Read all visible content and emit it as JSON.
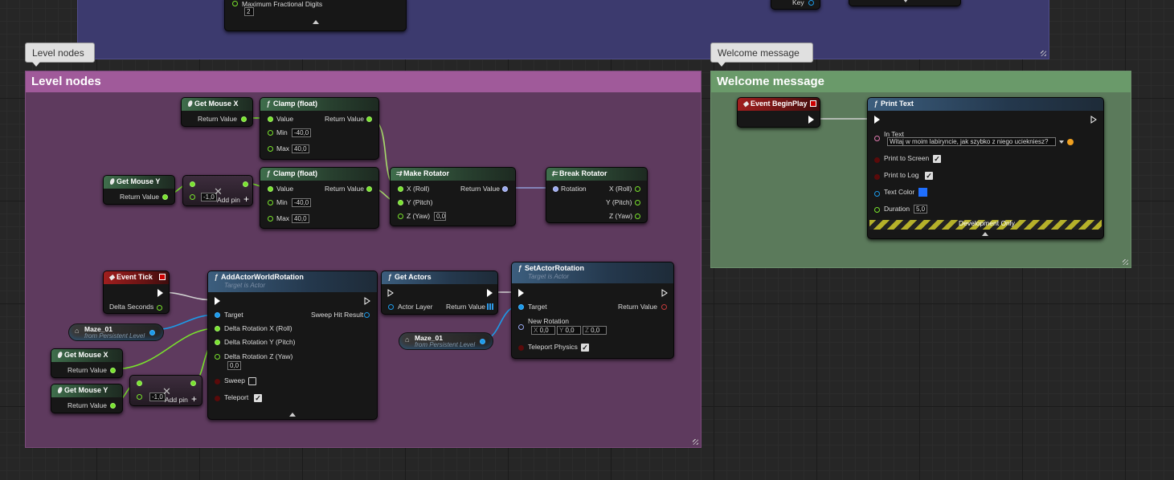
{
  "top_partial": {
    "max_fractional_digits_label": "Maximum Fractional Digits",
    "max_fractional_digits_value": "2",
    "key_label": "Key"
  },
  "comments": {
    "level": {
      "title": "Level nodes",
      "bubble": "Level nodes",
      "color": "#a05a9a"
    },
    "welcome": {
      "title": "Welcome message",
      "bubble": "Welcome message",
      "color": "#6a9a6a"
    }
  },
  "nodes": {
    "get_mouse_x_1": {
      "title": "Get Mouse X",
      "out": "Return Value"
    },
    "clamp_1": {
      "title": "Clamp (float)",
      "value": "Value",
      "return": "Return Value",
      "min": "Min",
      "min_val": "-40,0",
      "max": "Max",
      "max_val": "40,0"
    },
    "get_mouse_y_1": {
      "title": "Get Mouse Y",
      "out": "Return Value"
    },
    "multiply_1": {
      "val": "-1,0",
      "add_pin": "Add pin"
    },
    "clamp_2": {
      "title": "Clamp (float)",
      "value": "Value",
      "return": "Return Value",
      "min": "Min",
      "min_val": "-40,0",
      "max": "Max",
      "max_val": "40,0"
    },
    "make_rotator": {
      "title": "Make Rotator",
      "x": "X (Roll)",
      "y": "Y (Pitch)",
      "z": "Z (Yaw)",
      "z_val": "0,0",
      "return": "Return Value"
    },
    "break_rotator": {
      "title": "Break Rotator",
      "rotation": "Rotation",
      "x": "X (Roll)",
      "y": "Y (Pitch)",
      "z": "Z (Yaw)"
    },
    "event_tick": {
      "title": "Event Tick",
      "delta": "Delta Seconds"
    },
    "add_rotation": {
      "title": "AddActorWorldRotation",
      "subtitle": "Target is Actor",
      "target": "Target",
      "sweep_hit": "Sweep Hit Result",
      "dx": "Delta Rotation X (Roll)",
      "dy": "Delta Rotation Y (Pitch)",
      "dz": "Delta Rotation Z (Yaw)",
      "dz_val": "0,0",
      "sweep": "Sweep",
      "sweep_checked": false,
      "teleport": "Teleport",
      "teleport_checked": true
    },
    "maze_var_1": {
      "name": "Maze_01",
      "sub": "from Persistent Level"
    },
    "get_mouse_x_2": {
      "title": "Get Mouse X",
      "out": "Return Value"
    },
    "get_mouse_y_2": {
      "title": "Get Mouse Y",
      "out": "Return Value"
    },
    "multiply_2": {
      "val": "-1,0",
      "add_pin": "Add pin"
    },
    "get_actors": {
      "title": "Get Actors",
      "layer": "Actor Layer",
      "return": "Return Value"
    },
    "maze_var_2": {
      "name": "Maze_01",
      "sub": "from Persistent Level"
    },
    "set_rotation": {
      "title": "SetActorRotation",
      "subtitle": "Target is Actor",
      "target": "Target",
      "return": "Return Value",
      "new_rotation": "New Rotation",
      "x_lbl": "X",
      "x_val": "0,0",
      "y_lbl": "Y",
      "y_val": "0,0",
      "z_lbl": "Z",
      "z_val": "0,0",
      "teleport": "Teleport Physics",
      "teleport_checked": true
    },
    "begin_play": {
      "title": "Event BeginPlay"
    },
    "print_text": {
      "title": "Print Text",
      "in_text": "In Text",
      "in_text_val": "Witaj w moim labiryncie, jak szybko z niego uciekniesz?",
      "to_screen": "Print to Screen",
      "to_log": "Print to Log",
      "text_color": "Text Color",
      "text_color_hex": "#1f6fff",
      "duration": "Duration",
      "duration_val": "5,0",
      "dev_only": "Development Only"
    }
  }
}
